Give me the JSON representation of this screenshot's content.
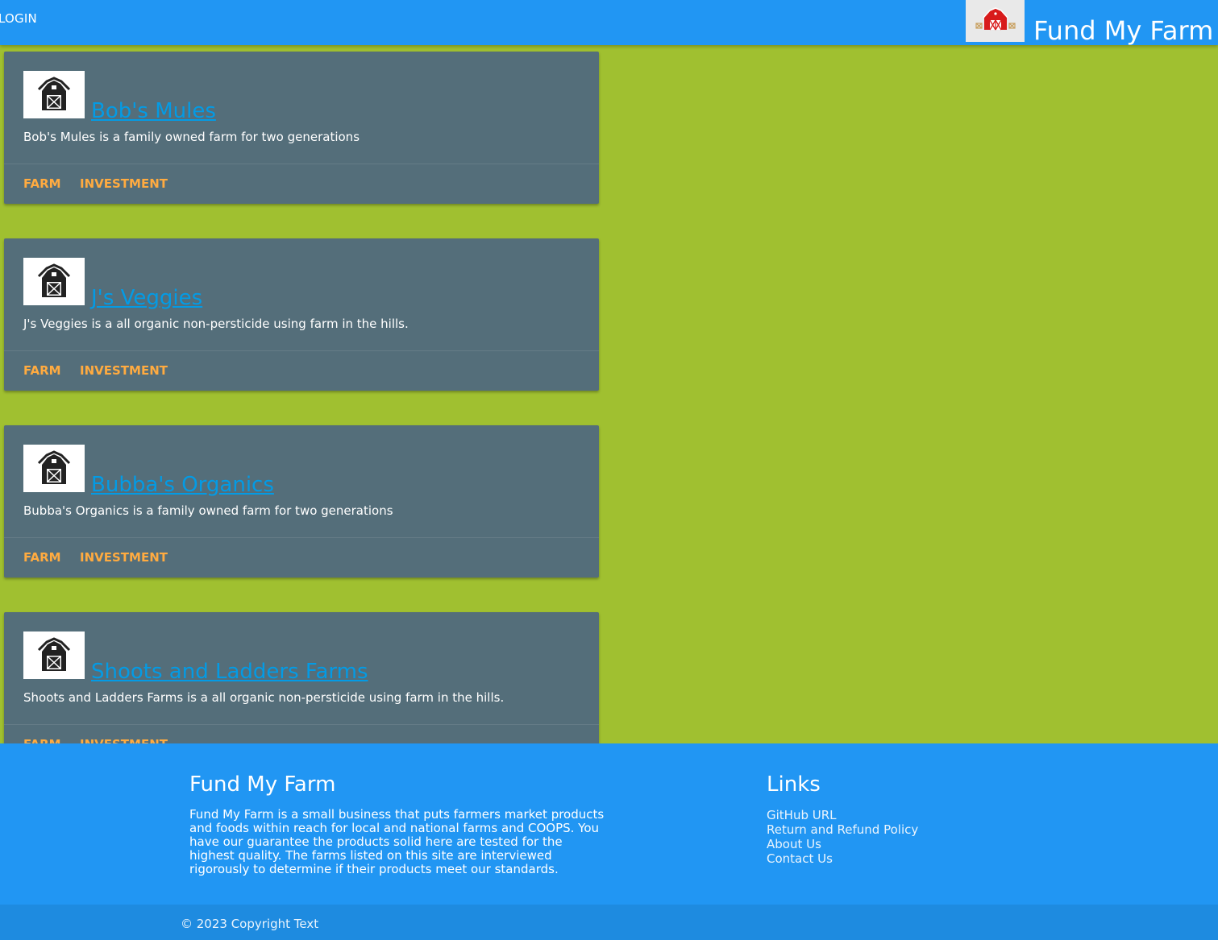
{
  "header": {
    "login_label": "LOGIN",
    "brand_title": "Fund My Farm",
    "logo_icon": "red-barn-icon",
    "bg_color": "#2196f3"
  },
  "cards": [
    {
      "title": "Bob's Mules",
      "description": "Bob's Mules is a family owned farm for two generations",
      "icon": "barn-icon",
      "actions": [
        "FARM",
        "INVESTMENT"
      ]
    },
    {
      "title": "J's Veggies",
      "description": "J's Veggies is a all organic non-persticide using farm in the hills.",
      "icon": "barn-icon",
      "actions": [
        "FARM",
        "INVESTMENT"
      ]
    },
    {
      "title": "Bubba's Organics",
      "description": "Bubba's Organics is a family owned farm for two generations",
      "icon": "barn-icon",
      "actions": [
        "FARM",
        "INVESTMENT"
      ]
    },
    {
      "title": "Shoots and Ladders Farms",
      "description": "Shoots and Ladders Farms is a all organic non-persticide using farm in the hills.",
      "icon": "barn-icon",
      "actions": [
        "FARM",
        "INVESTMENT"
      ]
    }
  ],
  "footer": {
    "about_title": "Fund My Farm",
    "about_text": "Fund My Farm is a small business that puts farmers market products and foods within reach for local and national farms and COOPS. You have our guarantee the products solid here are tested for the highest quality. The farms listed on this site are interviewed rigorously to determine if their products meet our standards.",
    "links_title": "Links",
    "links": [
      "GitHub URL",
      "Return and Refund Policy",
      "About Us",
      "Contact Us"
    ],
    "copyright": "© 2023 Copyright Text"
  },
  "colors": {
    "page_bg": "#a0c030",
    "card_bg": "#546e7a",
    "card_title": "#039be5",
    "card_action": "#ffab40",
    "footer_bg": "#2196f3"
  }
}
